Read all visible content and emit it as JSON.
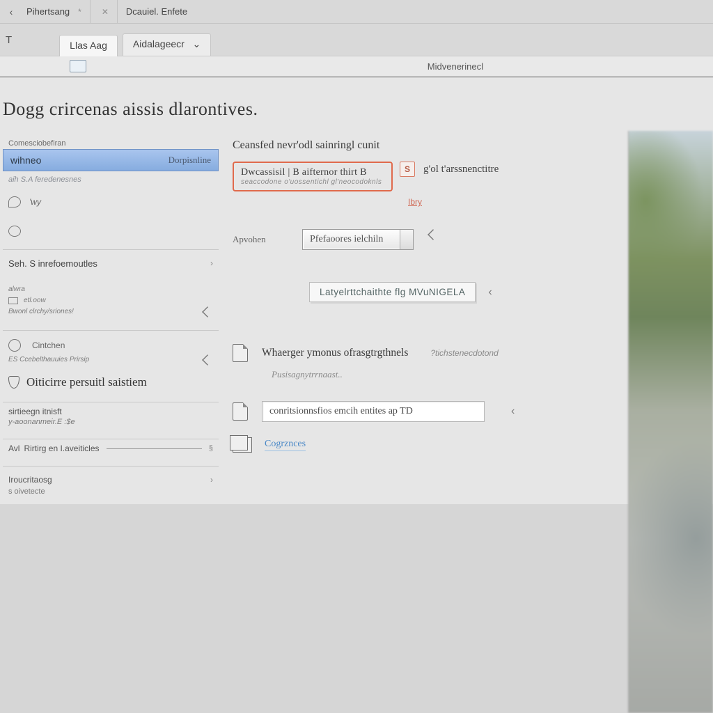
{
  "topbar": {
    "tab1": "Pihertsang",
    "tab2": "Dcauiel. Enfete",
    "t": "T",
    "inner_tab1": "Llas  Aag",
    "inner_tab2": "Aidalageecr",
    "inner_close": "⌄",
    "row3_label": "Midvenerinecl"
  },
  "page": {
    "title": "Dogg crircenas  aissis dlarontives."
  },
  "sidebar": {
    "top_small": "Comesciobefiran",
    "header_left": "wihneo",
    "header_right": "Dorpisnline",
    "muted_link": "aih  S.A feredenesnes",
    "block1_text": "'wy",
    "block2_row_a": "Seh.   S inrefoemoutles",
    "block2_small1": "alwra",
    "block2_small2": "etl.oow",
    "block2_small3": "Bwonl   clrchy/sriones!",
    "block3_small": "Cintchen",
    "block3_sub": "ES Ccebelthauuies   Prirsip",
    "block3_main": "Oiticirre persuitl  saistiem",
    "block4_title": "sirtieegn itnisft",
    "block4_val": "y-aoonanmeir.E  :$e",
    "inline_prefix": "Avl",
    "inline_text": "Rirtirg en I.aveiticles",
    "inline_end": "§",
    "foot_title": "Iroucritaosg",
    "foot_sub": "s  oivetecte"
  },
  "center": {
    "heading": "Ceansfed nevr'odl  sainringl cunit",
    "alert_line1": "Dwcassisil  | B  aifternor  thirt B",
    "alert_line2": "seaccodone o'uossentichl   gl'neocodoknls",
    "alert_btn": "S",
    "alert_trail": "g'ol  t'arssnenctitre",
    "alert_tiny": "Ibry",
    "field1_label": "Apvohen",
    "field1_value": "Pfefaoores ielchiln",
    "token_value": "Latyelrttchaithte flg MVuNIGELA",
    "section2_title": "Whaerger ymonus ofrasgtrgthnels",
    "section2_aside": "?tichstenecdotond",
    "section2_placeholder": "Pusisagnytrrnaast..",
    "section3_value": "conritsionnsfios  emcih entites  ap   TD",
    "link_label": "Cogrznces"
  }
}
